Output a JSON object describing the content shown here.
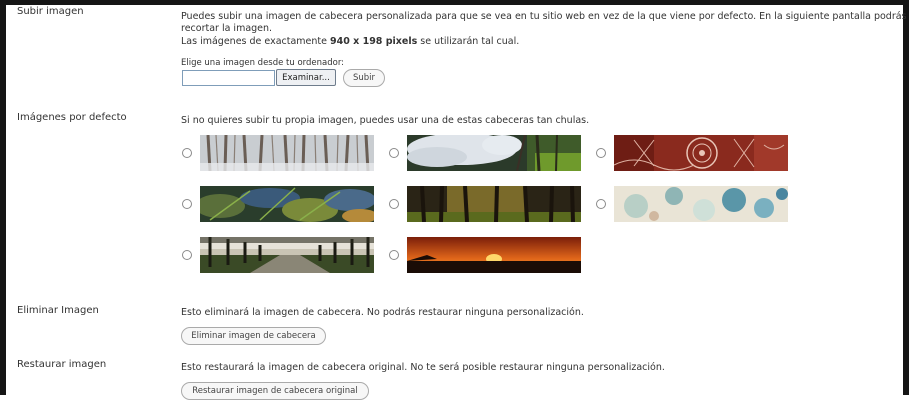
{
  "upload": {
    "label": "Subir imagen",
    "desc_line1": "Puedes subir una imagen de cabecera personalizada para que se vea en tu sitio web en vez de la que viene por defecto. En la siguiente pantalla podrás",
    "desc_line2": "recortar la imagen.",
    "desc_line3_pre": "Las imágenes de exactamente ",
    "desc_line3_bold": "940 x 198 pixels",
    "desc_line3_post": " se utilizarán tal cual.",
    "choose_label": "Elige una imagen desde tu ordenador:",
    "file_value": "",
    "browse_label": "Examinar...",
    "submit_label": "Subir"
  },
  "defaults": {
    "label": "Imágenes por defecto",
    "desc": "Si no quieres subir tu propia imagen, puedes usar una de estas cabeceras tan chulas.",
    "images": [
      {
        "name": "snowy-forest-header-image"
      },
      {
        "name": "blossom-tree-header-image"
      },
      {
        "name": "red-lace-pattern-header-image"
      },
      {
        "name": "ferns-header-image"
      },
      {
        "name": "forest-light-header-image"
      },
      {
        "name": "teal-stains-pattern-header-image"
      },
      {
        "name": "tree-avenue-header-image"
      },
      {
        "name": "sunset-header-image"
      }
    ]
  },
  "remove": {
    "label": "Eliminar Imagen",
    "desc": "Esto eliminará la imagen de cabecera. No podrás restaurar ninguna personalización.",
    "button_label": "Eliminar imagen de cabecera"
  },
  "restore": {
    "label": "Restaurar imagen",
    "desc": "Esto restaurará la imagen de cabecera original. No te será posible restaurar ninguna personalización.",
    "button_label": "Restaurar imagen de cabecera original"
  }
}
